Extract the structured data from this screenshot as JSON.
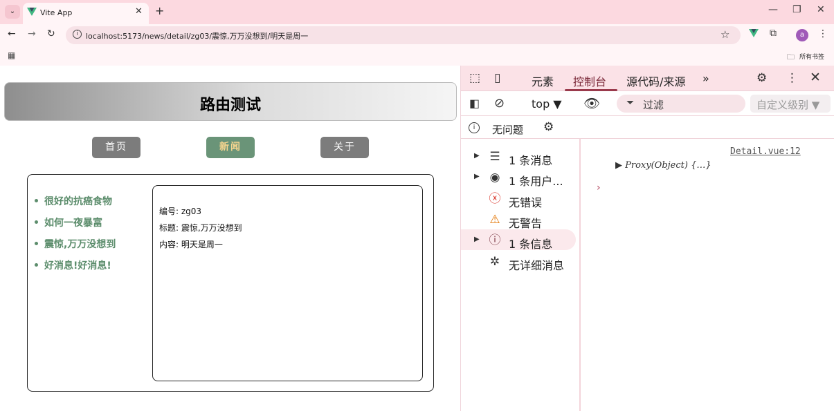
{
  "browser": {
    "tab_title": "Vite App",
    "url": "localhost:5173/news/detail/zg03/震惊,万万没想到/明天是周一",
    "bookmarks_label": "所有书签",
    "avatar_letter": "a"
  },
  "page": {
    "title": "路由测试",
    "nav": [
      {
        "label": "首页",
        "active": false
      },
      {
        "label": "新闻",
        "active": true
      },
      {
        "label": "关于",
        "active": false
      }
    ],
    "news_list": [
      "很好的抗癌食物",
      "如何一夜暴富",
      "震惊,万万没想到",
      "好消息!好消息!"
    ],
    "detail": {
      "id_line": "编号: zg03",
      "title_line": "标题: 震惊,万万没想到",
      "content_line": "内容: 明天是周一"
    }
  },
  "devtools": {
    "tabs": {
      "elements": "元素",
      "console": "控制台",
      "sources": "源代码/来源"
    },
    "context": "top ▼",
    "filter_placeholder": "过滤",
    "levels": "自定义级别 ▼",
    "issues": "无问题",
    "sidebar": [
      {
        "label": "1 条消息",
        "icon": "list-icon",
        "expandable": true
      },
      {
        "label": "1 条用户...",
        "icon": "user-icon",
        "expandable": true
      },
      {
        "label": "无错误",
        "icon": "error-icon",
        "expandable": false
      },
      {
        "label": "无警告",
        "icon": "warning-icon",
        "expandable": false
      },
      {
        "label": "1 条信息",
        "icon": "info-icon",
        "expandable": true,
        "active": true
      },
      {
        "label": "无详细消息",
        "icon": "bug-icon",
        "expandable": false
      }
    ],
    "console": {
      "source_link": "Detail.vue:12",
      "entry": "▶ Proxy(Object)  {…}",
      "prompt": "›"
    }
  },
  "colors": {
    "chrome_pink": "#fcd9e0",
    "active_nav": "#6a9478",
    "news_green": "#5c8d6c"
  }
}
